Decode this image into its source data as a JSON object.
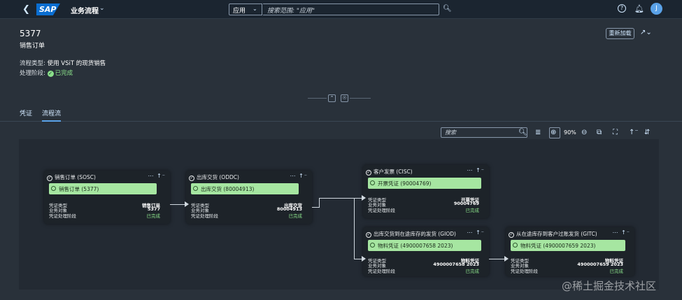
{
  "shell": {
    "logo": "SAP",
    "app_title": "业务流程",
    "scope": "应用",
    "search_placeholder": "搜索范围: \"应用\"",
    "avatar": "J"
  },
  "header": {
    "object_id": "5377",
    "object_type": "销售订单",
    "reload_label": "重新加载",
    "attrs": [
      {
        "label": "流程类型:",
        "value": "使用 VSiT 的现货销售"
      },
      {
        "label": "处理阶段:",
        "value": "已完成"
      }
    ]
  },
  "tabs": [
    {
      "label": "凭证"
    },
    {
      "label": "流程流"
    }
  ],
  "toolbar": {
    "search_placeholder": "搜索",
    "zoom": "90%"
  },
  "rows": {
    "type": "凭证类型",
    "obj": "业务对象",
    "stage": "凭证处理阶段"
  },
  "nodes": [
    {
      "title": "销售订单 (SOSC)",
      "doc": "销售订单 (5377)",
      "type_val": "销售订单",
      "obj_val": "5377",
      "stage_val": "已完成"
    },
    {
      "title": "出库交货 (ODDC)",
      "doc": "出库交货 (80004913)",
      "type_val": "出库交货",
      "obj_val": "80004913",
      "stage_val": "已完成"
    },
    {
      "title": "客户发票 (CISC)",
      "doc": "开票凭证 (90004769)",
      "type_val": "开票凭证",
      "obj_val": "90004769",
      "stage_val": "已完成"
    },
    {
      "title": "出库交货到在途库存的发货 (GIOD)",
      "doc": "物料凭证 (4900007658 2023)",
      "type_val": "物料凭证",
      "obj_val": "4900007658 2023",
      "stage_val": "已完成"
    },
    {
      "title": "从在途库存到客户过账发货 (GITC)",
      "doc": "物料凭证 (4900007659 2023)",
      "type_val": "物料凭证",
      "obj_val": "4900007659 2023",
      "stage_val": "已完成"
    }
  ],
  "watermark": "@稀土掘金技术社区",
  "colors": {
    "accent": "#5aa2e8",
    "success": "#8ae08a",
    "doc_fill": "#a6e6a1",
    "shell_bg": "#1b2530",
    "page_bg": "#29313a"
  }
}
